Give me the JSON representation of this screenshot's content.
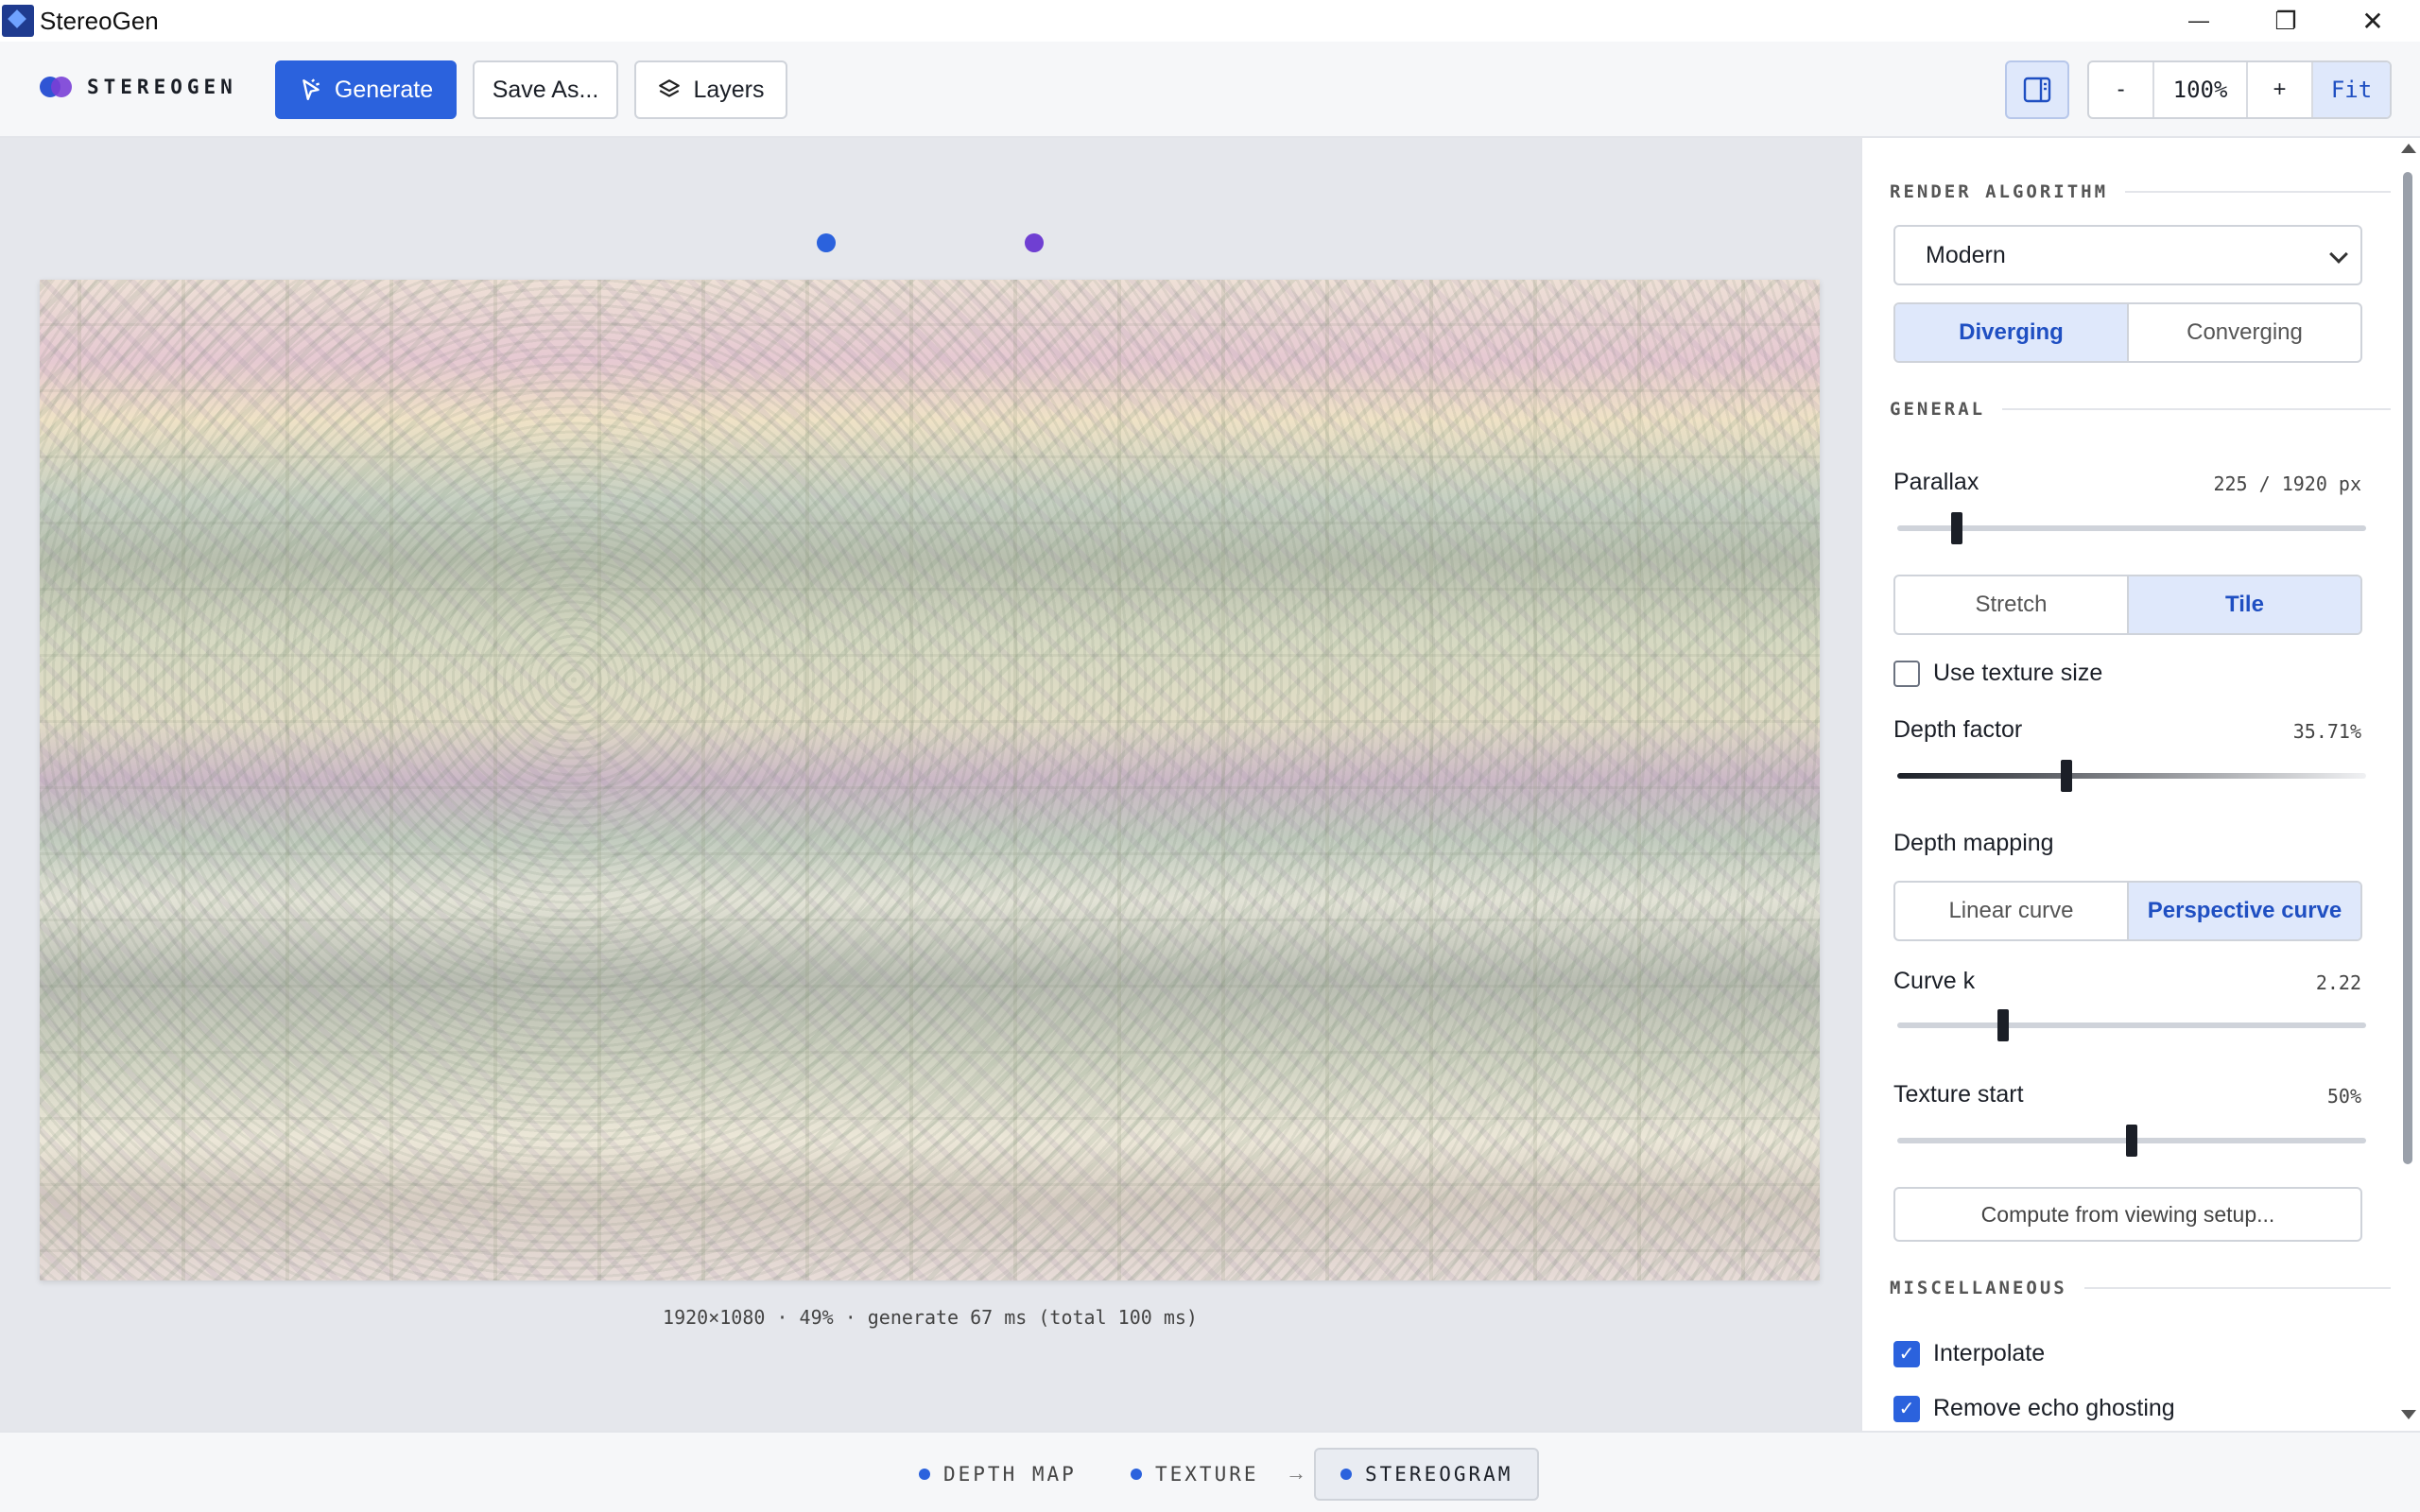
{
  "window": {
    "title": "StereoGen",
    "minimize": "—",
    "maximize": "❐",
    "close": "✕"
  },
  "toolbar": {
    "brand": "STEREOGEN",
    "generate_label": "Generate",
    "save_as_label": "Save As...",
    "layers_label": "Layers",
    "zoom_out": "-",
    "zoom_level": "100%",
    "zoom_in": "+",
    "fit_label": "Fit"
  },
  "canvas": {
    "status": "1920×1080 · 49% · generate 67 ms (total 100 ms)",
    "marker_colors": [
      "#2b62dd",
      "#6f3fd2"
    ]
  },
  "panel": {
    "render_algorithm": {
      "section": "RENDER ALGORITHM",
      "selected": "Modern",
      "modes": [
        "Diverging",
        "Converging"
      ],
      "active_mode": "Diverging"
    },
    "general": {
      "section": "GENERAL",
      "parallax_label": "Parallax",
      "parallax_value": "225 / 1920 px",
      "parallax_fraction": 0.117,
      "fill_modes": [
        "Stretch",
        "Tile"
      ],
      "active_fill": "Tile",
      "use_texture_size_label": "Use texture size",
      "use_texture_size": false,
      "depth_factor_label": "Depth factor",
      "depth_factor_value": "35.71%",
      "depth_factor_fraction": 0.3571,
      "depth_mapping_label": "Depth mapping",
      "mapping_modes": [
        "Linear curve",
        "Perspective curve"
      ],
      "active_mapping": "Perspective curve",
      "curve_k_label": "Curve k",
      "curve_k_value": "2.22",
      "curve_k_fraction": 0.22,
      "texture_start_label": "Texture start",
      "texture_start_value": "50%",
      "texture_start_fraction": 0.5,
      "compute_button": "Compute from viewing setup..."
    },
    "misc": {
      "section": "MISCELLANEOUS",
      "interpolate_label": "Interpolate",
      "interpolate": true,
      "remove_echo_label": "Remove echo ghosting",
      "remove_echo": true
    }
  },
  "bottom_tabs": {
    "depth_map": "DEPTH MAP",
    "texture": "TEXTURE",
    "arrow": "→",
    "stereogram": "STEREOGRAM",
    "active": "STEREOGRAM"
  },
  "colors": {
    "accent": "#2b62dd",
    "accent_light": "#dfe8fb"
  }
}
